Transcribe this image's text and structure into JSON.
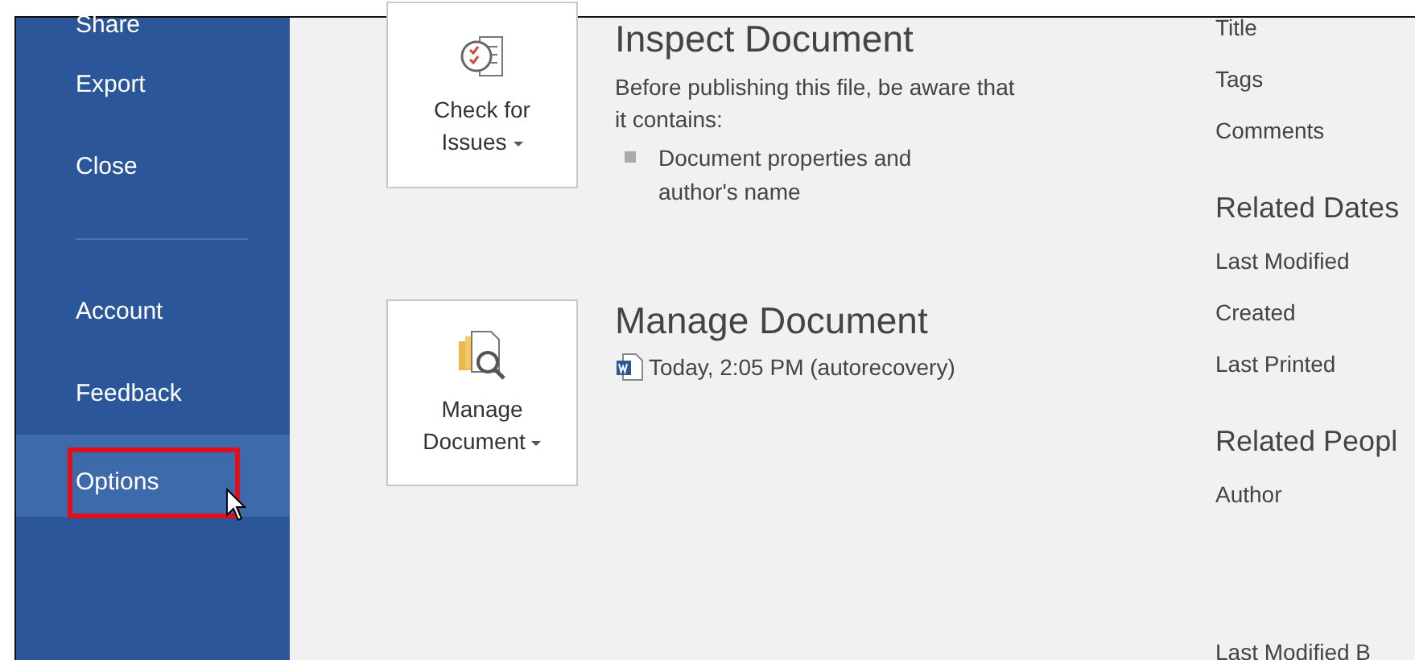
{
  "sidebar": {
    "groups": [
      {
        "items": [
          {
            "label": "Share",
            "selected": false
          },
          {
            "label": "Export",
            "selected": false
          },
          {
            "label": "Close",
            "selected": false
          }
        ]
      },
      {
        "items": [
          {
            "label": "Account",
            "selected": false
          },
          {
            "label": "Feedback",
            "selected": false
          },
          {
            "label": "Options",
            "selected": true
          }
        ]
      }
    ]
  },
  "sections": [
    {
      "kind": "inspect",
      "button_label": "Check for Issues",
      "heading": "Inspect Document",
      "description": "Before publishing this file, be aware that it contains:",
      "bullets": [
        "Document properties and author's name"
      ]
    },
    {
      "kind": "manage",
      "button_label": "Manage Document",
      "heading": "Manage Document",
      "versions": [
        "Today, 2:05 PM (autorecovery)"
      ]
    }
  ],
  "properties": {
    "groups": [
      {
        "items": [
          "Title",
          "Tags",
          "Comments"
        ]
      },
      {
        "heading": "Related Dates",
        "items": [
          "Last Modified",
          "Created",
          "Last Printed"
        ]
      },
      {
        "heading": "Related Peopl",
        "items": [
          "Author"
        ]
      }
    ],
    "footer_item": "Last Modified B"
  }
}
